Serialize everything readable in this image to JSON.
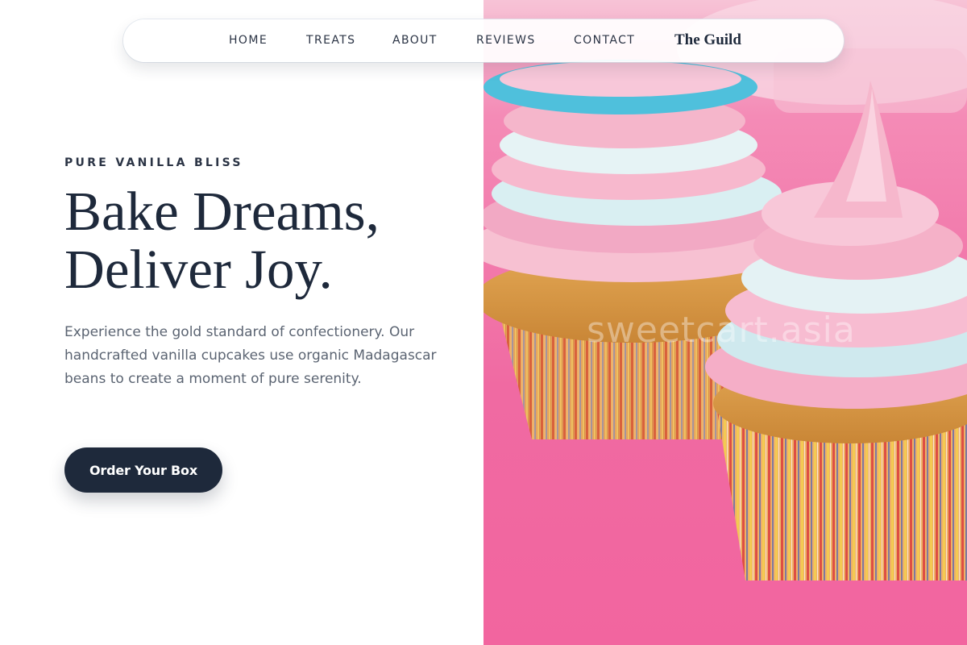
{
  "nav": {
    "items": [
      {
        "label": "HOME"
      },
      {
        "label": "TREATS"
      },
      {
        "label": "ABOUT"
      },
      {
        "label": "REVIEWS"
      },
      {
        "label": "CONTACT"
      }
    ],
    "brand": "The Guild"
  },
  "hero": {
    "eyebrow": "PURE VANILLA BLISS",
    "headline_line1": "Bake Dreams,",
    "headline_line2": "Deliver Joy.",
    "description": "Experience the gold standard of confectionery. Our handcrafted vanilla cupcakes use organic Madagascar beans to create a moment of pure serenity.",
    "cta_label": "Order Your Box"
  },
  "image": {
    "watermark": "sweetcart.asia"
  },
  "colors": {
    "navy": "#1e293b",
    "background_pink": "#f06aa2",
    "frosting_pink": "#f7b3cc",
    "frosting_blue": "#b9e3ea",
    "body_text": "#5b6472"
  }
}
